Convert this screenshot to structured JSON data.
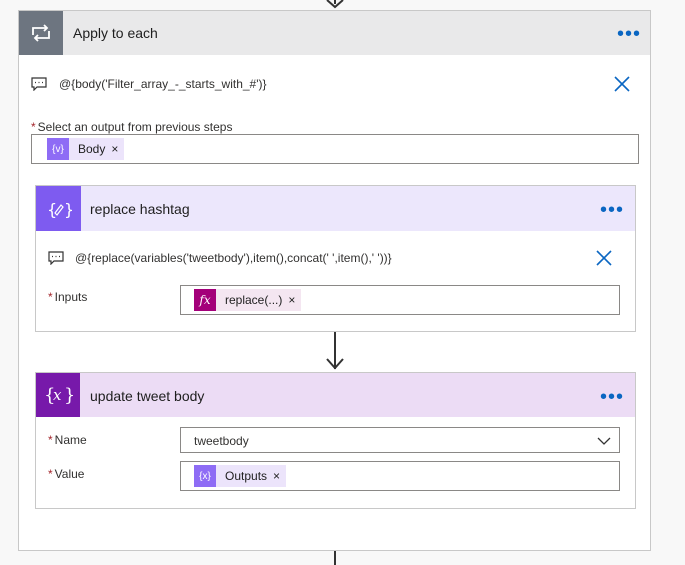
{
  "loop": {
    "title": "Apply to each",
    "expression": "@{body('Filter_array_-_starts_with_#')}",
    "output_label": "Select an output from previous steps",
    "required_mark": "*",
    "token_label": "Body",
    "token_icon": "{v}",
    "token_close": "×"
  },
  "replace_action": {
    "title": "replace hashtag",
    "expression": "@{replace(variables('tweetbody'),item(),concat(' ',item(),' '))}",
    "inputs_label": "Inputs",
    "required_mark": "*",
    "token_label": "replace(...)",
    "token_icon": "fx",
    "token_close": "×"
  },
  "update_action": {
    "title": "update tweet body",
    "name_label": "Name",
    "name_value": "tweetbody",
    "value_label": "Value",
    "required_mark": "*",
    "token_label": "Outputs",
    "token_icon": "{x}",
    "token_close": "×"
  },
  "colors": {
    "accent_blue": "#0a66c2",
    "variable_purple": "#7e5bf0",
    "expression_magenta": "#a4007a",
    "update_purple": "#7719aa",
    "loop_gray": "#6d7580"
  },
  "menu_dots": "•••"
}
